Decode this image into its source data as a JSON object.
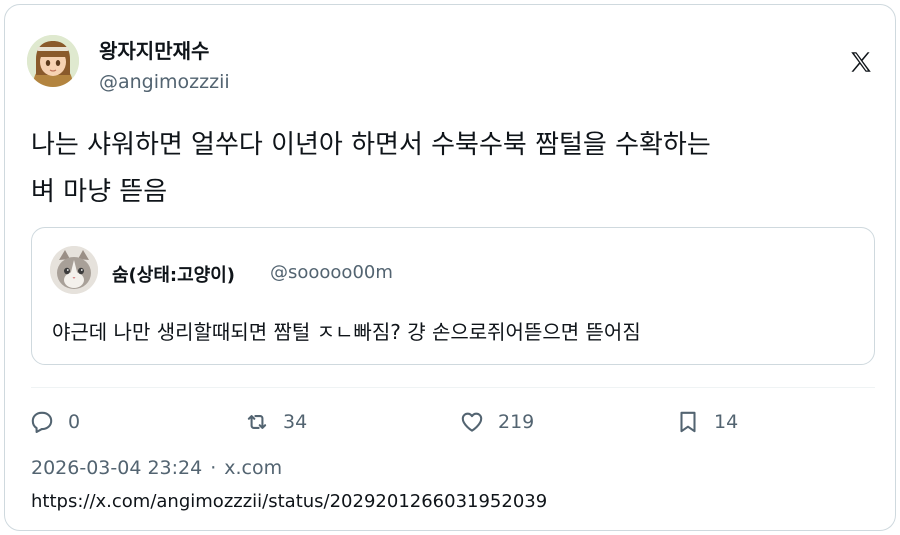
{
  "author": {
    "name": "왕자지만재수",
    "handle": "@angimozzzii",
    "avatar_icon": "anime-character-avatar"
  },
  "brand_icon": "x-logo-icon",
  "tweet": {
    "text_line1": "나는 샤워하면 얼쑤다 이년아 하면서 수북수북 짬털을 수확하는",
    "text_line2": "벼 마냥 뜯음"
  },
  "quote": {
    "name": "숨(상태:고양이)",
    "handle": "@sooooo00m",
    "avatar_icon": "cat-avatar",
    "text": "야근데 나만 생리할때되면 짬털 ㅈㄴ빠짐? 걍 손으로쥐어뜯으면 뜯어짐"
  },
  "actions": {
    "reply": {
      "icon": "reply-icon",
      "count": "0"
    },
    "retweet": {
      "icon": "retweet-icon",
      "count": "34"
    },
    "like": {
      "icon": "heart-icon",
      "count": "219"
    },
    "bookmark": {
      "icon": "bookmark-icon",
      "count": "14"
    }
  },
  "meta": {
    "timestamp": "2026-03-04 23:24",
    "separator": "·",
    "source": "x.com"
  },
  "status_url": "https://x.com/angimozzzii/status/2029201266031952039",
  "colors": {
    "text": "#0f1419",
    "secondary": "#536471",
    "border": "#cfd9de"
  }
}
